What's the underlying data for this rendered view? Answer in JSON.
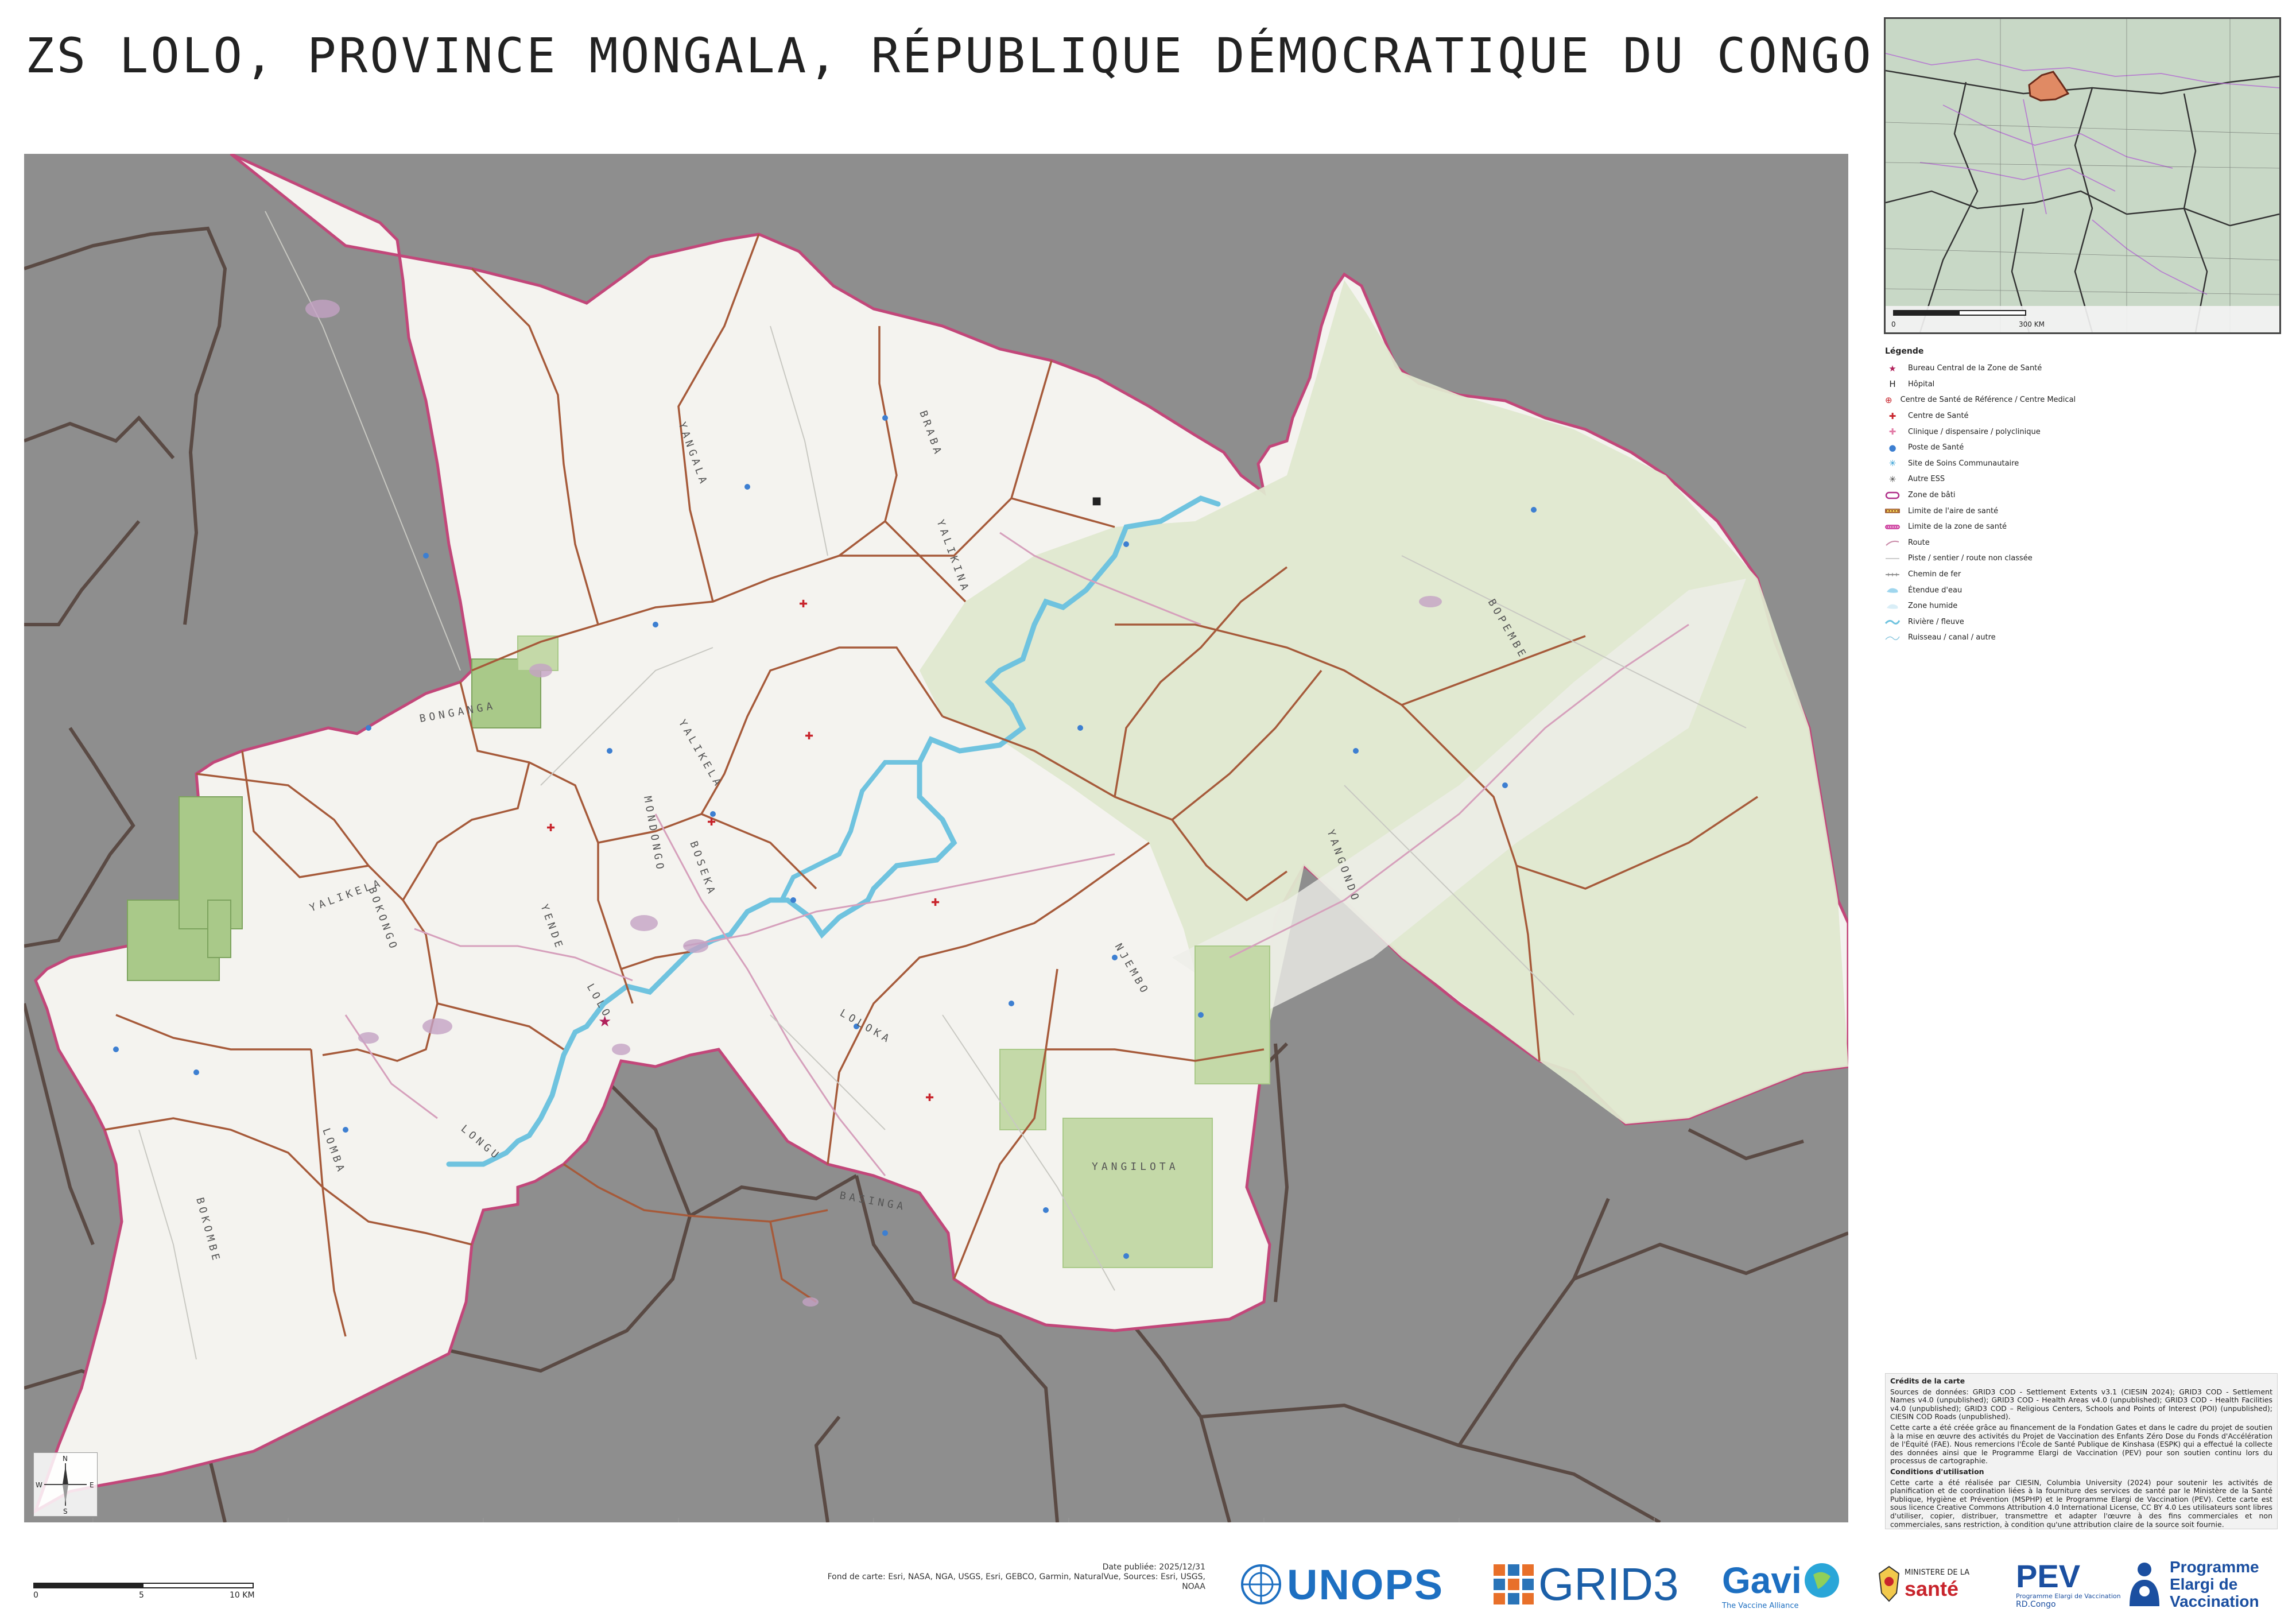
{
  "title": "ZS LOLO, PROVINCE MONGALA, RÉPUBLIQUE DÉMOCRATIQUE DU CONGO",
  "colors": {
    "outside": "#8e8e8e",
    "zone": "#f4f3ef",
    "forest": "#dfe8cf",
    "plantation": "#a9c989",
    "boundary_zone": "#c2477a",
    "boundary_area": "#a65a3a",
    "river": "#6fc3df"
  },
  "map": {
    "area_labels": [
      "YANGALA",
      "BRABA",
      "YALIKINA",
      "BONGANGA",
      "YALIKELA",
      "MONDONGO",
      "LOLO",
      "BOSEKA",
      "YENDE",
      "BOPEMBE",
      "BOKONGO",
      "NJEMBO",
      "LOLOKA",
      "YANGONDO",
      "LOMBA",
      "LONGU",
      "BOKOMBE",
      "BASINGA",
      "YANGILOTA"
    ]
  },
  "inset": {
    "scale_label": "300 KM",
    "scale_zero": "0"
  },
  "legend": {
    "title": "Légende",
    "items": [
      {
        "symbol": "★",
        "color": "#b0205a",
        "label": "Bureau Central de la Zone de Santé"
      },
      {
        "symbol": "H",
        "color": "#222222",
        "label": "Hôpital"
      },
      {
        "symbol": "⊕",
        "color": "#c8242c",
        "label": "Centre de Santé de Référence / Centre Medical"
      },
      {
        "symbol": "✚",
        "color": "#c8242c",
        "label": "Centre de Santé"
      },
      {
        "symbol": "✚",
        "color": "#e27aa6",
        "label": "Clinique / dispensaire / polyclinique"
      },
      {
        "symbol": "●",
        "color": "#3d7fd1",
        "label": "Poste de Santé"
      },
      {
        "symbol": "✳",
        "color": "#2a9ad3",
        "label": "Site de Soins Communautaire"
      },
      {
        "symbol": "✳",
        "color": "#444444",
        "label": "Autre ESS"
      },
      {
        "symbol": "zone",
        "color": "#b0308a",
        "label": "Zone de bâti"
      },
      {
        "symbol": "dash",
        "color": "#8a3a1c",
        "label": "Limite de l'aire de santé"
      },
      {
        "symbol": "dash2",
        "color": "#c2188a",
        "label": "Limite de la zone de santé"
      },
      {
        "symbol": "road",
        "color": "#c98aa8",
        "label": "Route"
      },
      {
        "symbol": "line",
        "color": "#bbbbbb",
        "label": "Piste / sentier / route non classée"
      },
      {
        "symbol": "rail",
        "color": "#777777",
        "label": "Chemin de fer"
      },
      {
        "symbol": "water",
        "color": "#9fd6ee",
        "label": "Étendue d'eau"
      },
      {
        "symbol": "wet",
        "color": "#d9eef7",
        "label": "Zone humide"
      },
      {
        "symbol": "river",
        "color": "#6fc3df",
        "label": "Rivière / fleuve"
      },
      {
        "symbol": "stream",
        "color": "#8ec9e0",
        "label": "Ruisseau / canal / autre"
      }
    ]
  },
  "credits": {
    "heading": "Crédits de la carte",
    "sources": "Sources de données: GRID3 COD - Settlement Extents v3.1 (CIESIN 2024); GRID3 COD - Settlement Names v4.0 (unpublished); GRID3 COD - Health Areas v4.0 (unpublished); GRID3 COD - Health Facilities v4.0 (unpublished); GRID3 COD – Religious Centers, Schools and Points of Interest (POI) (unpublished); CIESIN COD Roads (unpublished).",
    "funding": "Cette carte a été créée grâce au financement de la Fondation Gates et dans le cadre du projet de soutien à la mise en œuvre des activités du Projet de Vaccination des Enfants Zéro Dose du Fonds d'Accélération de l'Équité (FAE). Nous remercions l'École de Santé Publique de Kinshasa (ESPK) qui a effectué la collecte des données ainsi que le Programme Elargi de Vaccination (PEV) pour son soutien continu lors du processus de cartographie.",
    "conditions_heading": "Conditions d'utilisation",
    "conditions": "Cette carte a été réalisée par CIESIN, Columbia University (2024) pour soutenir les activités de planification et de coordination liées à la fourniture des services de santé par le Ministère de la Santé Publique, Hygiène et Prévention (MSPHP) et le Programme Elargi de Vaccination (PEV). Cette carte est sous licence Creative Commons Attribution 4.0 International License, CC BY 4.0 Les utilisateurs sont libres d'utiliser, copier, distribuer, transmettre et adapter l'œuvre à des fins commerciales et non commerciales, sans restriction, à condition qu'une attribution claire de la source soit fournie."
  },
  "scale": {
    "labels": [
      "0",
      "5",
      "10 KM"
    ]
  },
  "footer": {
    "date": "Date publiée: 2025/12/31",
    "basemap": "Fond de carte: Esri, NASA, NGA, USGS, Esri, GEBCO, Garmin, NaturalVue, Sources: Esri, USGS, NOAA"
  },
  "logos": {
    "unops": "UNOPS",
    "grid3": "GRID3",
    "gavi": "Gavi",
    "gavi_sub": "The Vaccine Alliance",
    "ministere": "MINISTERE DE LA",
    "sante": "santé",
    "pev": "PEV",
    "pev_sub": "Programme Elargi de Vaccination",
    "pev_country": "RD.Congo",
    "programme_lines": [
      "Programme",
      "Elargi de",
      "Vaccination"
    ]
  },
  "compass": {
    "n": "N",
    "s": "S",
    "e": "E",
    "w": "W"
  }
}
